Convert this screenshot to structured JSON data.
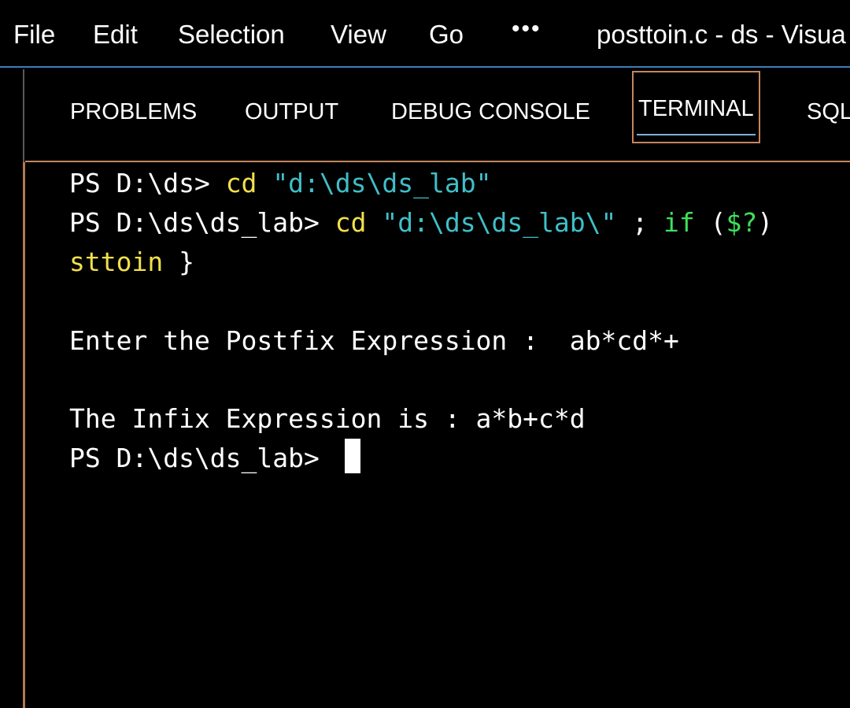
{
  "menubar": {
    "items": [
      "File",
      "Edit",
      "Selection",
      "View",
      "Go"
    ],
    "more_label": "•••",
    "window_title": "posttoin.c - ds - Visua"
  },
  "panel": {
    "tabs": [
      "PROBLEMS",
      "OUTPUT",
      "DEBUG CONSOLE",
      "TERMINAL",
      "SQL"
    ],
    "active_tab": "TERMINAL"
  },
  "terminal": {
    "line1": {
      "prompt": "PS D:\\ds> ",
      "cmd": "cd",
      "space": " ",
      "arg": "\"d:\\ds\\ds_lab\""
    },
    "line2": {
      "prompt": "PS D:\\ds\\ds_lab> ",
      "cmd": "cd",
      "space": " ",
      "arg": "\"d:\\ds\\ds_lab\\\"",
      "sep": " ; ",
      "kw": "if",
      "rest": " (",
      "var": "$?",
      "close": ")"
    },
    "line3": {
      "text": "sttoin",
      "brace": " }"
    },
    "line4": "Enter the Postfix Expression :  ab*cd*+",
    "line5": "The Infix Expression is : a*b+c*d",
    "line6": "PS D:\\ds\\ds_lab> "
  },
  "colors": {
    "background": "#000000",
    "command": "#f1e04b",
    "string": "#3fbfc8",
    "keyword": "#3ee05a",
    "active_tab_border": "#c4865e",
    "menubar_border": "#3a7fb8"
  }
}
